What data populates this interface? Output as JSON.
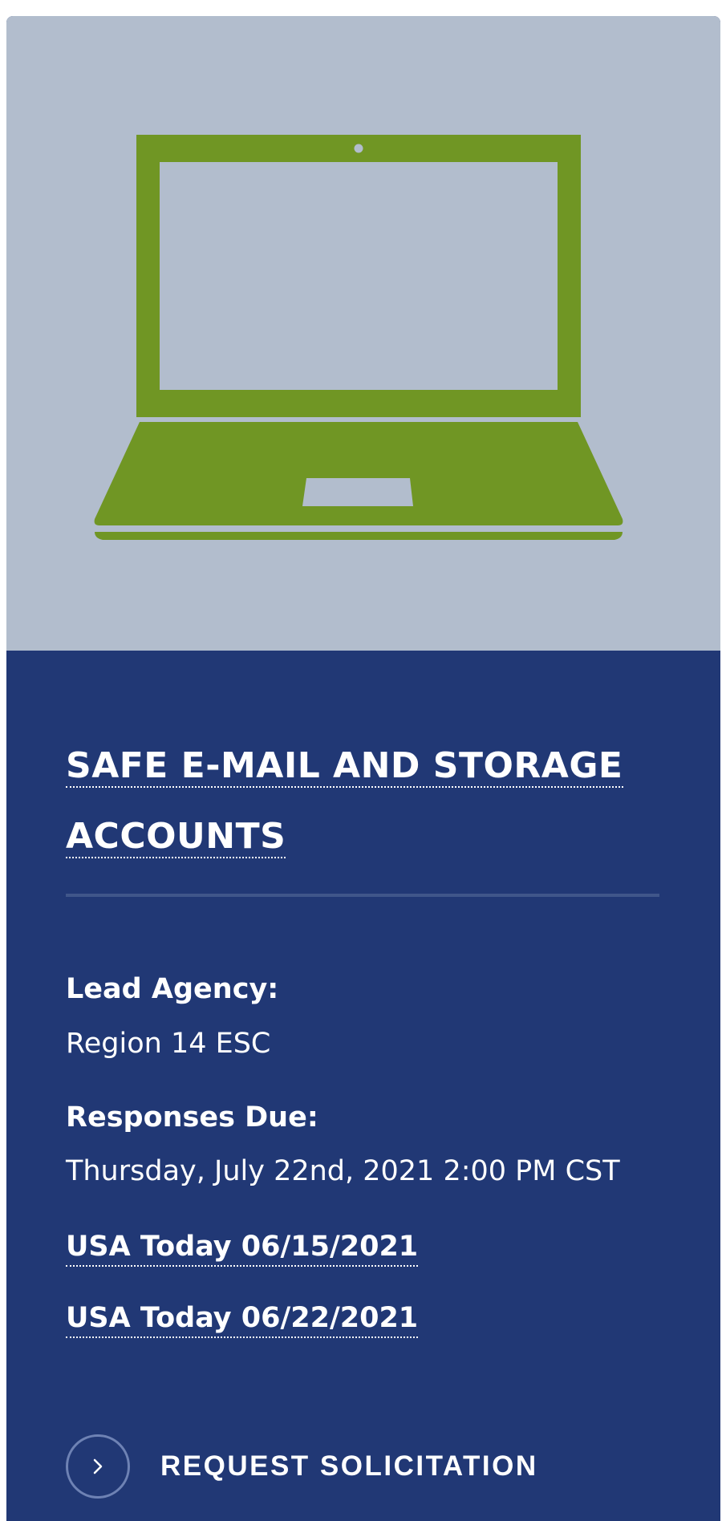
{
  "card": {
    "image_icon": "laptop-icon",
    "colors": {
      "hero_bg": "#b2bdcd",
      "icon_green": "#709624",
      "body_bg": "#213875",
      "divider": "#40568a",
      "text": "#ffffff"
    },
    "title_lines": [
      "SAFE E-MAIL AND STORAGE",
      "ACCOUNTS"
    ],
    "lead_agency": {
      "label": "Lead Agency:",
      "value": "Region 14 ESC"
    },
    "responses_due": {
      "label": "Responses Due:",
      "value": "Thursday, July 22nd, 2021 2:00 PM CST"
    },
    "links": [
      "USA Today 06/15/2021",
      "USA Today 06/22/2021"
    ],
    "cta": {
      "label": "REQUEST SOLICITATION",
      "icon": "chevron-right-icon"
    }
  }
}
